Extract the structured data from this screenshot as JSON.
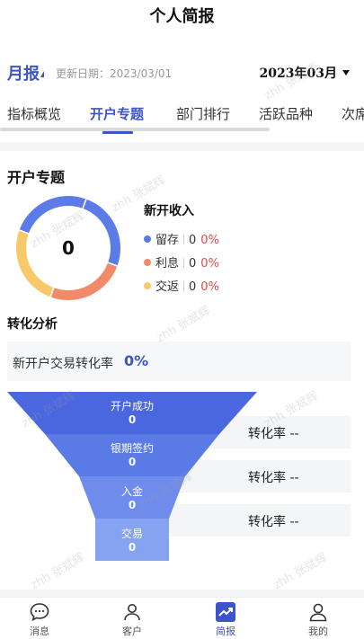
{
  "header": {
    "title": "个人简报"
  },
  "subbar": {
    "period": "月报",
    "update_date": "更新日期：2023/03/01",
    "month": "2023年03月"
  },
  "tabs": [
    {
      "label": "指标概览"
    },
    {
      "label": "开户专题"
    },
    {
      "label": "部门排行"
    },
    {
      "label": "活跃品种"
    },
    {
      "label": "次席"
    }
  ],
  "section": {
    "title": "开户专题",
    "donut_center": "0",
    "legend_title": "新开收入",
    "legend": [
      {
        "name": "留存",
        "value": "0",
        "pct": "0%",
        "color": "#5b7be8"
      },
      {
        "name": "利息",
        "value": "0",
        "pct": "0%",
        "color": "#f28a6a"
      },
      {
        "name": "交返",
        "value": "0",
        "pct": "0%",
        "color": "#f7c96a"
      }
    ],
    "donut_share": [
      0.25,
      0.25,
      0.25,
      0.25
    ],
    "donut_colors": [
      "#5b7be8",
      "#f28a6a",
      "#f7c96a",
      "#5b7be8"
    ]
  },
  "conversion": {
    "title": "转化分析",
    "rate_label": "新开户交易转化率",
    "rate_value": "0%",
    "funnel": [
      {
        "label": "开户成功",
        "value": "0",
        "color": "#4a67e0"
      },
      {
        "label": "银期签约",
        "value": "0",
        "color": "#5a7ae6"
      },
      {
        "label": "入金",
        "value": "0",
        "color": "#6d8cec"
      },
      {
        "label": "交易",
        "value": "0",
        "color": "#86a3f2"
      }
    ],
    "rates": [
      "转化率 --",
      "转化率 --",
      "转化率 --"
    ]
  },
  "nav": [
    {
      "label": "消息",
      "icon": "chat-bubble-icon"
    },
    {
      "label": "客户",
      "icon": "person-icon"
    },
    {
      "label": "简报",
      "icon": "trend-chart-icon"
    },
    {
      "label": "我的",
      "icon": "profile-icon"
    }
  ],
  "watermark": "zhh 张斌辉",
  "colors": {
    "accent": "#3b55c8",
    "danger": "#e04848"
  }
}
